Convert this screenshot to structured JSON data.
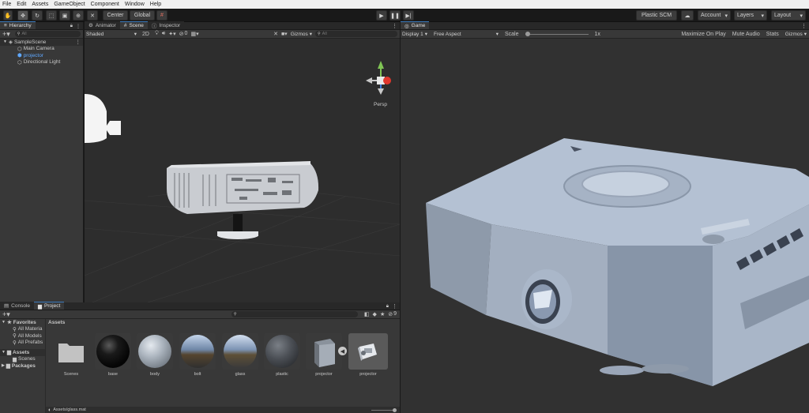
{
  "menu": [
    "File",
    "Edit",
    "Assets",
    "GameObject",
    "Component",
    "Window",
    "Help"
  ],
  "toolbar": {
    "pivot_label": "Center",
    "space_label": "Global",
    "plastic_label": "Plastic SCM",
    "account_label": "Account",
    "layers_label": "Layers",
    "layout_label": "Layout"
  },
  "hierarchy": {
    "tab_label": "Hierarchy",
    "search_placeholder": "All",
    "scene_name": "SampleScene",
    "items": [
      {
        "label": "Main Camera"
      },
      {
        "label": "projector"
      },
      {
        "label": "Directional Light"
      }
    ]
  },
  "scene_tabs": {
    "animator": "Animator",
    "scene": "Scene",
    "inspector": "Inspector"
  },
  "scene_bar": {
    "shading": "Shaded",
    "mode_2d": "2D",
    "fx_count": "0",
    "gizmos": "Gizmos",
    "search_placeholder": "All",
    "persp_label": "Persp"
  },
  "game": {
    "tab_label": "Game",
    "display": "Display 1",
    "aspect": "Free Aspect",
    "scale_label": "Scale",
    "scale_value": "1x",
    "scale_fraction": 0.0,
    "maximize": "Maximize On Play",
    "mute": "Mute Audio",
    "stats": "Stats",
    "gizmos": "Gizmos"
  },
  "project": {
    "tabs": {
      "console": "Console",
      "project": "Project"
    },
    "favorites_label": "Favorites",
    "favorites": [
      "All Materia",
      "All Models",
      "All Prefabs"
    ],
    "tree_assets": "Assets",
    "tree_scenes": "Scenes",
    "tree_packages": "Packages",
    "breadcrumb": "Assets",
    "hidden_count": "9",
    "footer_path": "Assets/glass.mat",
    "assets": [
      {
        "label": "Scenes",
        "type": "folder"
      },
      {
        "label": "base",
        "type": "material",
        "color": "#0b0b0b"
      },
      {
        "label": "body",
        "type": "material",
        "color": "#9aa3ad"
      },
      {
        "label": "bolt",
        "type": "material",
        "color": "#6f7f93"
      },
      {
        "label": "glass",
        "type": "material",
        "color": "#7f8ea3"
      },
      {
        "label": "plastic",
        "type": "material",
        "color": "#4a4d52"
      },
      {
        "label": "projector",
        "type": "model"
      },
      {
        "label": "projector",
        "type": "prefab"
      }
    ]
  },
  "colors": {
    "accent": "#3a79bb",
    "selected_text": "#5fa8ff",
    "projector_body": "#a9b6c9"
  }
}
